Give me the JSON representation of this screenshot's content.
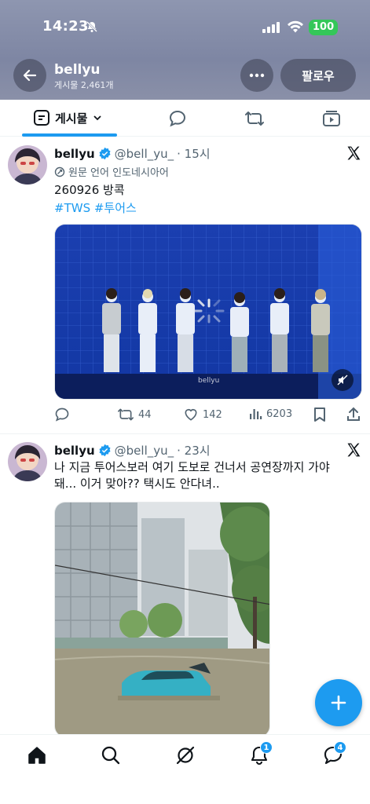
{
  "status_bar": {
    "time": "14:23",
    "battery": "100"
  },
  "profile": {
    "name": "bellyu",
    "post_count": "게시물 2,461개",
    "follow_label": "팔로우"
  },
  "tabs": {
    "posts_label": "게시물"
  },
  "tweets": [
    {
      "name": "bellyu",
      "handle": "@bell_yu_",
      "time": "· 15시",
      "translated_label": "원문 언어 인도네시아어",
      "text": "260926 방콕",
      "hashtags": "#TWS #투어스",
      "media_watermark": "bellyu",
      "replies": "",
      "retweets": "44",
      "likes": "142",
      "views": "6203"
    },
    {
      "name": "bellyu",
      "handle": "@bell_yu_",
      "time": "· 23시",
      "text_line1": "나 지금 투어스보러 여기 도보로 건너서 공연장까지 가야",
      "text_line2": "돼... 이거 맞아?? 택시도 안다녀.."
    }
  ],
  "bottom_nav": {
    "notifications_badge": "1",
    "messages_badge": "4"
  },
  "colors": {
    "accent": "#1d9bf0",
    "header_bg": "#8a91ab",
    "battery": "#34c759"
  },
  "icons": [
    "back-arrow-icon",
    "more-icon",
    "posts-tab-icon",
    "chevron-down-icon",
    "reply-tab-icon",
    "repost-tab-icon",
    "video-tab-icon",
    "verified-icon",
    "x-logo-icon",
    "translate-icon",
    "reply-icon",
    "retweet-icon",
    "like-icon",
    "views-icon",
    "bookmark-icon",
    "share-icon",
    "compose-plus-icon",
    "home-icon",
    "search-icon",
    "grok-icon",
    "bell-icon",
    "messages-icon"
  ]
}
